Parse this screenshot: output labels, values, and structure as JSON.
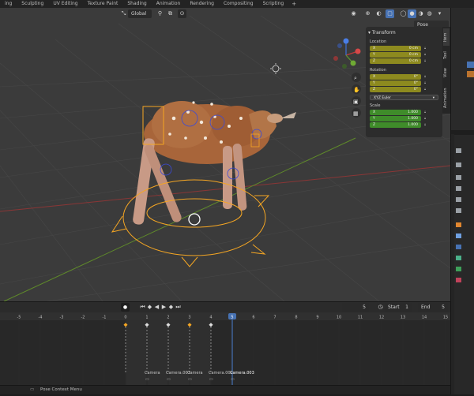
{
  "workspace_tabs": [
    "ing",
    "Sculpting",
    "UV Editing",
    "Texture Paint",
    "Shading",
    "Animation",
    "Rendering",
    "Compositing",
    "Scripting"
  ],
  "workspace_add": "+",
  "viewport": {
    "orientation_label": "Global",
    "pose_options": "Pose Options"
  },
  "transform_panel": {
    "title": "Transform",
    "location_label": "Location",
    "location": [
      {
        "axis": "X",
        "value": "0 cm"
      },
      {
        "axis": "Y",
        "value": "0 cm"
      },
      {
        "axis": "Z",
        "value": "0 cm"
      }
    ],
    "rotation_label": "Rotation",
    "rotation": [
      {
        "axis": "X",
        "value": "0°"
      },
      {
        "axis": "Y",
        "value": "0°"
      },
      {
        "axis": "Z",
        "value": "0°"
      }
    ],
    "rotation_mode": "XYZ Euler",
    "scale_label": "Scale",
    "scale": [
      {
        "axis": "X",
        "value": "1.000"
      },
      {
        "axis": "Y",
        "value": "1.000"
      },
      {
        "axis": "Z",
        "value": "1.000"
      }
    ]
  },
  "sidebar_tabs": [
    "Item",
    "Tool",
    "View",
    "Animation"
  ],
  "timeline": {
    "current_frame": "5",
    "start_label": "Start",
    "start": "1",
    "end_label": "End",
    "end": "5",
    "ticks": [
      "-5",
      "-4",
      "-3",
      "-2",
      "-1",
      "0",
      "1",
      "2",
      "3",
      "4",
      "5",
      "6",
      "7",
      "8",
      "9",
      "10",
      "11",
      "12",
      "13",
      "14",
      "15",
      "16"
    ],
    "markers": [
      "Camera",
      "Camera.001",
      "Camera",
      "Camera.002",
      "Camera.003"
    ]
  },
  "status": {
    "context_menu": "Pose Context Menu"
  },
  "colors": {
    "accent_blue": "#4772b3",
    "selection_orange": "#f5a623",
    "axis_red": "#a33a3a",
    "axis_green": "#6f9a2e"
  }
}
